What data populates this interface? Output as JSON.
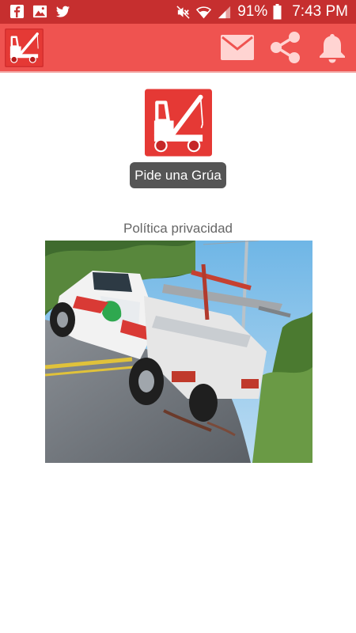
{
  "status_bar": {
    "battery": "91%",
    "time": "7:43 PM",
    "left_icons": [
      "facebook-icon",
      "gallery-icon",
      "twitter-icon"
    ],
    "right_icons": [
      "mute-icon",
      "wifi-icon",
      "signal-icon",
      "battery-icon"
    ]
  },
  "app_bar": {
    "logo": "tow-truck-logo",
    "actions": [
      "mail-icon",
      "share-icon",
      "bell-icon"
    ]
  },
  "main": {
    "request_button_label": "Pide una Grúa",
    "privacy_link": "Política privacidad",
    "photo_subject": "tow-truck-photo"
  },
  "colors": {
    "status_bar": "#c62f2f",
    "app_bar": "#ef5350",
    "button": "#555555",
    "logo_red": "#e53935"
  }
}
